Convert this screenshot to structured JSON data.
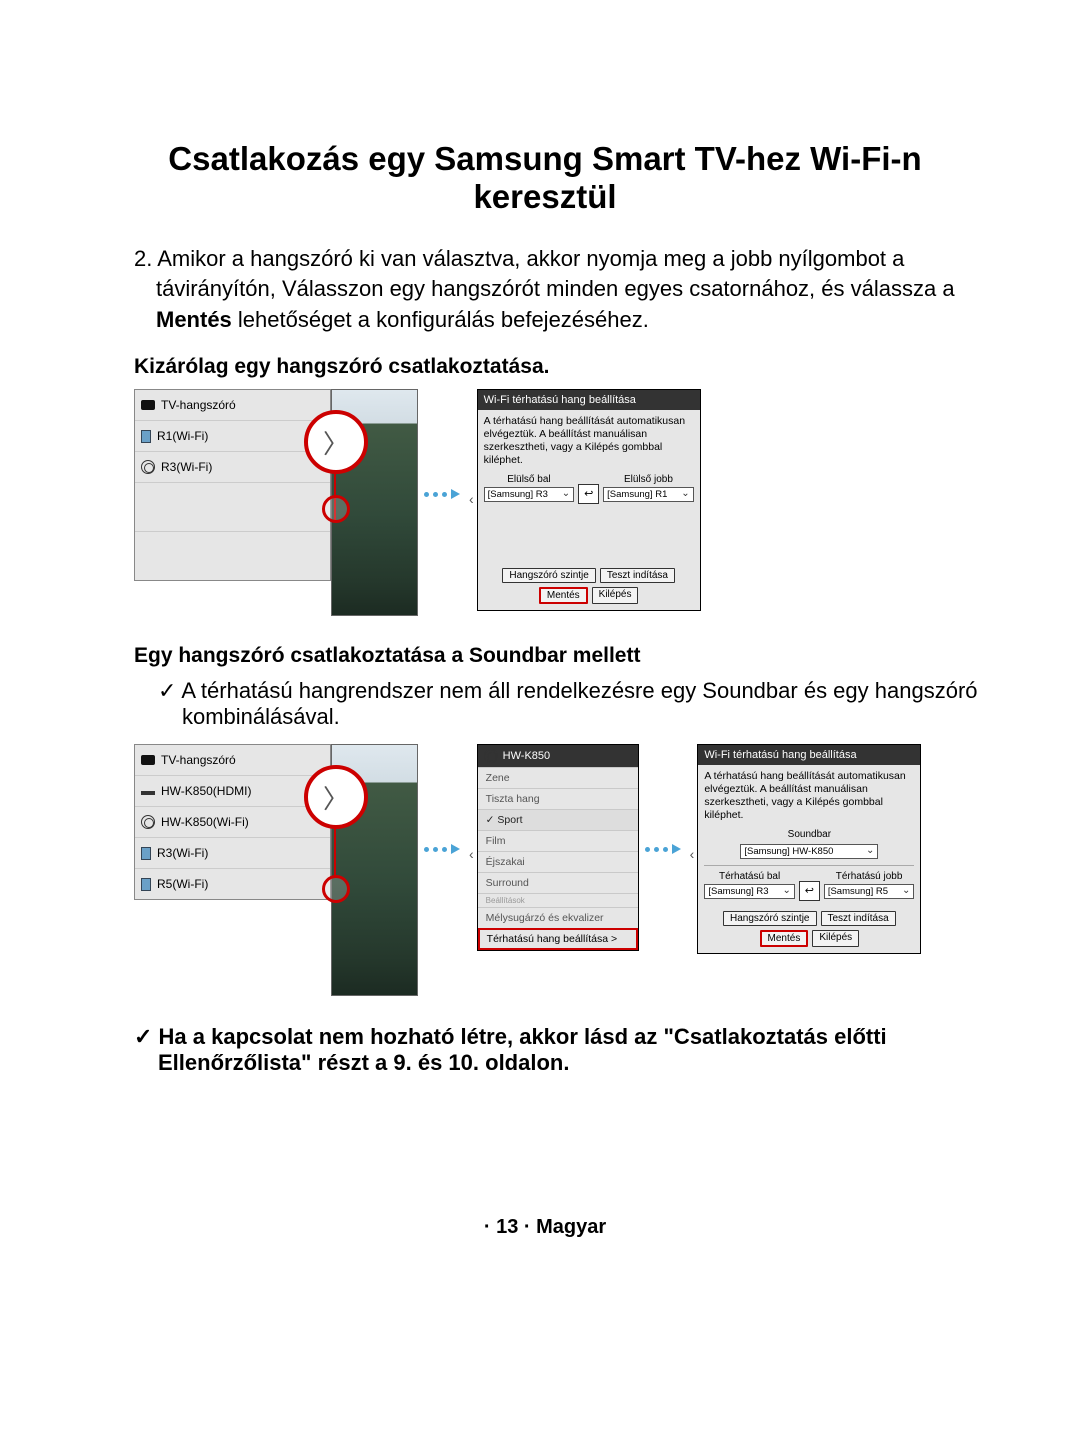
{
  "title": "Csatlakozás egy Samsung Smart TV-hez Wi-Fi-n keresztül",
  "instruction_prefix": "2. ",
  "instruction_part1": "Amikor a hangszóró ki van választva, akkor nyomja meg a jobb nyílgombot a távirányítón, Válasszon egy hangszórót minden egyes csatornához, és válassza a ",
  "instruction_bold": "Mentés",
  "instruction_part2": " lehetőséget a konfigurálás befejezéséhez.",
  "section1": "Kizárólag egy hangszóró csatlakoztatása.",
  "section2": "Egy hangszóró csatlakoztatása a Soundbar mellett",
  "check1": "✓ A térhatású hangrendszer nem áll rendelkezésre egy Soundbar és egy hangszóró kombinálásával.",
  "check2": "✓ Ha a kapcsolat nem hozható létre, akkor lásd az \"Csatlakoztatás előtti Ellenőrzőlista\" részt a 9. és 10. oldalon.",
  "list1": {
    "tv": "TV-hangszóró",
    "r1": "R1(Wi-Fi)",
    "r3": "R3(Wi-Fi)"
  },
  "list2": {
    "tv": "TV-hangszóró",
    "hdmi": "HW-K850(HDMI)",
    "wifi": "HW-K850(Wi-Fi)",
    "r3": "R3(Wi-Fi)",
    "r5": "R5(Wi-Fi)"
  },
  "popup1": {
    "title": "Wi-Fi térhatású hang beállítása",
    "desc": "A térhatású hang beállítását automatikusan elvégeztük. A beállítást manuálisan szerkesztheti, vagy a Kilépés gombbal kiléphet.",
    "left_label": "Elülső bal",
    "right_label": "Elülső jobb",
    "left_sel": "[Samsung] R3",
    "right_sel": "[Samsung] R1",
    "btn_level": "Hangszóró szintje",
    "btn_test": "Teszt indítása",
    "btn_save": "Mentés",
    "btn_exit": "Kilépés"
  },
  "menu2": {
    "title": "HW-K850",
    "items": [
      "Zene",
      "Tiszta hang",
      "Sport",
      "Film",
      "Éjszakai",
      "Surround"
    ],
    "tiny": "Beállítások",
    "sub": "Mélysugárzó és ekvalizer",
    "hl": "Térhatású hang beállítása >"
  },
  "popup2": {
    "title": "Wi-Fi térhatású hang beállítása",
    "desc": "A térhatású hang beállítását automatikusan elvégeztük. A beállítást manuálisan szerkesztheti, vagy a Kilépés gombbal kiléphet.",
    "sb_label": "Soundbar",
    "sb_sel": "[Samsung] HW-K850",
    "left_label": "Térhatású bal",
    "right_label": "Térhatású jobb",
    "left_sel": "[Samsung] R3",
    "right_sel": "[Samsung] R5",
    "btn_level": "Hangszóró szintje",
    "btn_test": "Teszt indítása",
    "btn_save": "Mentés",
    "btn_exit": "Kilépés"
  },
  "callout_glyph": "〉",
  "footer": "· 13 · Magyar"
}
